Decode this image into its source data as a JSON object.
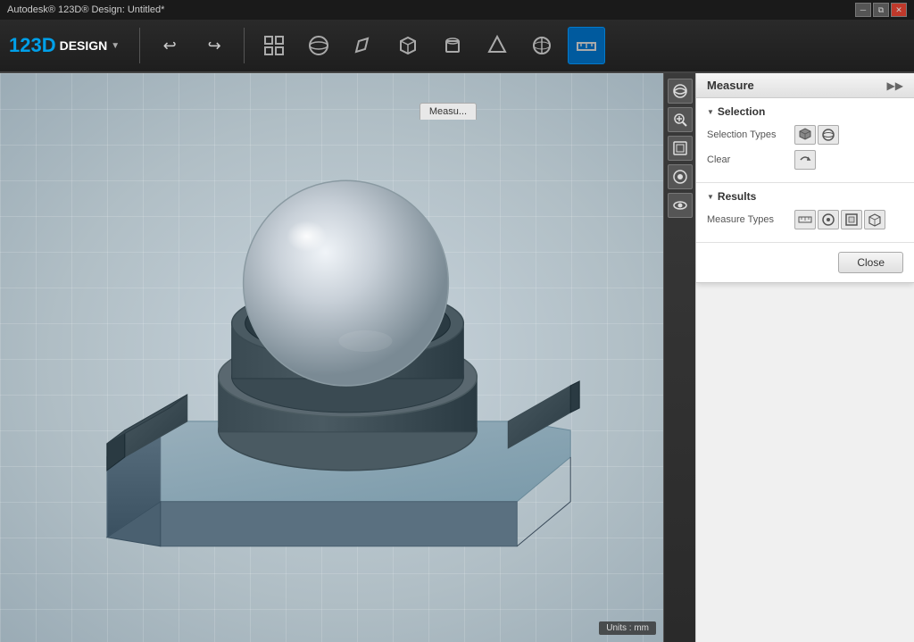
{
  "titleBar": {
    "appName": "Autodesk® 123D® Design: Untitled*",
    "controls": [
      "minimize",
      "restore",
      "close"
    ]
  },
  "toolbar": {
    "logo": "123D",
    "designLabel": "DESIGN",
    "dropdownArrow": "▼",
    "buttons": [
      {
        "name": "undo",
        "icon": "↩",
        "label": "Undo"
      },
      {
        "name": "redo",
        "icon": "↪",
        "label": "Redo"
      },
      {
        "name": "snap",
        "icon": "⊕",
        "label": "Snap"
      },
      {
        "name": "primitive",
        "icon": "●",
        "label": "Primitives"
      },
      {
        "name": "sketch",
        "icon": "✏",
        "label": "Sketch"
      },
      {
        "name": "box",
        "icon": "◻",
        "label": "Box"
      },
      {
        "name": "cylinder",
        "icon": "⬡",
        "label": "Cylinder"
      },
      {
        "name": "construct",
        "icon": "⚙",
        "label": "Construct"
      },
      {
        "name": "modify",
        "icon": "◈",
        "label": "Modify"
      },
      {
        "name": "pattern",
        "icon": "⊞",
        "label": "Pattern"
      },
      {
        "name": "measure",
        "icon": "📐",
        "label": "Measure",
        "active": true
      }
    ]
  },
  "measurePanel": {
    "title": "Measure",
    "expandIcon": "▶▶",
    "sections": {
      "selection": {
        "header": "Selection",
        "fields": {
          "selectionTypes": {
            "label": "Selection Types",
            "buttons": [
              {
                "icon": "⬡",
                "name": "face-select",
                "title": "Face"
              },
              {
                "icon": "○",
                "name": "edge-select",
                "title": "Edge"
              }
            ]
          },
          "clear": {
            "label": "Clear",
            "buttons": [
              {
                "icon": "↺",
                "name": "clear-btn",
                "title": "Clear"
              }
            ]
          }
        }
      },
      "results": {
        "header": "Results",
        "fields": {
          "measureTypes": {
            "label": "Measure Types",
            "buttons": [
              {
                "icon": "▤",
                "name": "linear-measure",
                "title": "Linear"
              },
              {
                "icon": "⊙",
                "name": "arc-measure",
                "title": "Arc"
              },
              {
                "icon": "⊡",
                "name": "area-measure",
                "title": "Area"
              },
              {
                "icon": "◫",
                "name": "volume-measure",
                "title": "Volume"
              }
            ]
          }
        }
      }
    },
    "closeButton": "Close"
  },
  "viewport": {
    "measureTab": "Measu...",
    "unitsLabel": "Units : mm",
    "rightToolbar": [
      "🔄",
      "🔍",
      "⬛",
      "👁",
      "🔘"
    ]
  }
}
